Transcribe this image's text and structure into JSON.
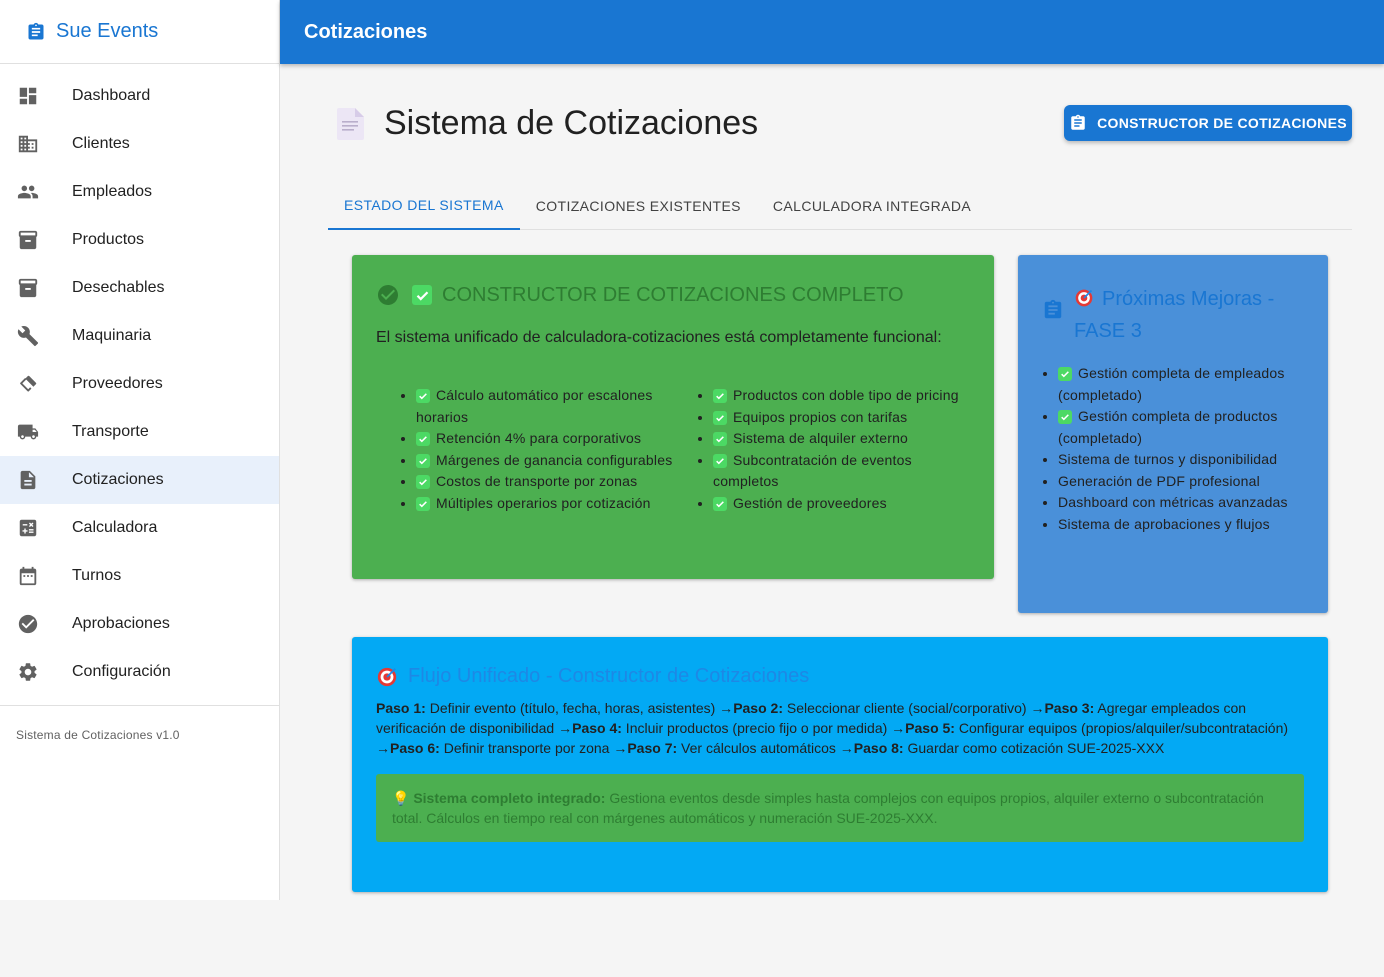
{
  "app": {
    "name": "Sue Events"
  },
  "topbar": {
    "title": "Cotizaciones"
  },
  "sidebar": {
    "items": [
      {
        "label": "Dashboard",
        "icon": "dashboard-icon"
      },
      {
        "label": "Clientes",
        "icon": "building-icon"
      },
      {
        "label": "Empleados",
        "icon": "people-icon"
      },
      {
        "label": "Productos",
        "icon": "archive-icon"
      },
      {
        "label": "Desechables",
        "icon": "archive-icon"
      },
      {
        "label": "Maquinaria",
        "icon": "wrench-icon"
      },
      {
        "label": "Proveedores",
        "icon": "handshake-icon"
      },
      {
        "label": "Transporte",
        "icon": "truck-icon"
      },
      {
        "label": "Cotizaciones",
        "icon": "document-icon",
        "active": true
      },
      {
        "label": "Calculadora",
        "icon": "calculator-icon"
      },
      {
        "label": "Turnos",
        "icon": "calendar-icon"
      },
      {
        "label": "Aprobaciones",
        "icon": "check-circle-icon"
      },
      {
        "label": "Configuración",
        "icon": "gear-icon"
      }
    ],
    "version": "Sistema de Cotizaciones v1.0"
  },
  "page": {
    "title": "Sistema de Cotizaciones",
    "builder_button": "CONSTRUCTOR DE COTIZACIONES"
  },
  "tabs": [
    {
      "label": "ESTADO DEL SISTEMA",
      "active": true
    },
    {
      "label": "COTIZACIONES EXISTENTES"
    },
    {
      "label": "CALCULADORA INTEGRADA"
    }
  ],
  "status_card": {
    "title": "CONSTRUCTOR DE COTIZACIONES COMPLETO",
    "description": "El sistema unificado de calculadora-cotizaciones está completamente funcional:",
    "left_features": [
      "Cálculo automático por escalones horarios",
      "Retención 4% para corporativos",
      "Márgenes de ganancia configurables",
      "Costos de transporte por zonas",
      "Múltiples operarios por cotización"
    ],
    "right_features": [
      "Productos con doble tipo de pricing",
      "Equipos propios con tarifas",
      "Sistema de alquiler externo",
      "Subcontratación de eventos completos",
      "Gestión de proveedores"
    ]
  },
  "next_card": {
    "title": "Próximas Mejoras - FASE 3",
    "items": [
      {
        "text": "Gestión completa de empleados (completado)",
        "done": true
      },
      {
        "text": "Gestión completa de productos (completado)",
        "done": true
      },
      {
        "text": "Sistema de turnos y disponibilidad",
        "done": false
      },
      {
        "text": "Generación de PDF profesional",
        "done": false
      },
      {
        "text": "Dashboard con métricas avanzadas",
        "done": false
      },
      {
        "text": "Sistema de aprobaciones y flujos",
        "done": false
      }
    ]
  },
  "flow_card": {
    "title": "Flujo Unificado - Constructor de Cotizaciones",
    "steps": [
      {
        "label": "Paso 1:",
        "text": " Definir evento (título, fecha, horas, asistentes) →"
      },
      {
        "label": "Paso 2:",
        "text": " Seleccionar cliente (social/corporativo) →"
      },
      {
        "label": "Paso 3:",
        "text": " Agregar empleados con verificación de disponibilidad →"
      },
      {
        "label": "Paso 4:",
        "text": " Incluir productos (precio fijo o por medida) →"
      },
      {
        "label": "Paso 5:",
        "text": " Configurar equipos (propios/alquiler/subcontratación) →"
      },
      {
        "label": "Paso 6:",
        "text": " Definir transporte por zona →"
      },
      {
        "label": "Paso 7:",
        "text": " Ver cálculos automáticos →"
      },
      {
        "label": "Paso 8:",
        "text": " Guardar como cotización SUE-2025-XXX"
      }
    ],
    "note_label": "Sistema completo integrado:",
    "note_text": " Gestiona eventos desde simples hasta complejos con equipos propios, alquiler externo o subcontratación total. Cálculos en tiempo real con márgenes automáticos y numeración SUE-2025-XXX."
  },
  "colors": {
    "primary": "#1976d2",
    "green_card": "#4caf50",
    "blue_card": "#4a90d9",
    "flow_card": "#03a9f4"
  }
}
